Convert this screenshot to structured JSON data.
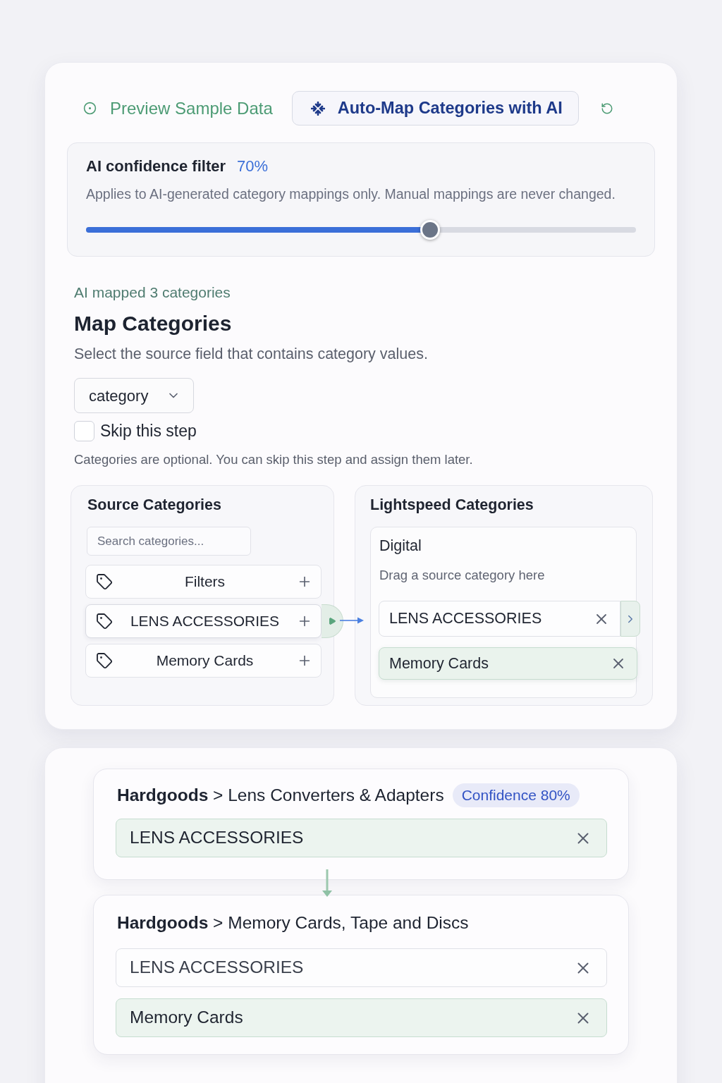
{
  "toolbar": {
    "preview_link": {
      "label": "Preview Sample Data"
    },
    "auto_map_button": {
      "label": "Auto-Map Categories with AI"
    }
  },
  "confidence_filter": {
    "title": "AI confidence filter",
    "value": "70%",
    "description": "Applies to AI-generated category mappings only. Manual mappings are never changed.",
    "level": 0.625
  },
  "status": "AI mapped 3 categories",
  "heading": "Map Categories",
  "instruction": "Select the source field that contains category values.",
  "source_field_select": {
    "value": "category"
  },
  "skip_step": {
    "label": "Skip this step",
    "checked": false
  },
  "hint": "Categories are optional. You can skip this step and assign them later.",
  "source_panel": {
    "title": "Source Categories",
    "search": {
      "placeholder": "Search categories..."
    },
    "items": [
      {
        "label": "Filters",
        "selected": false
      },
      {
        "label": "LENS ACCESSORIES",
        "selected": true
      },
      {
        "label": "Memory Cards",
        "selected": false
      }
    ]
  },
  "target_panel": {
    "title": "Lightspeed Categories",
    "group": {
      "name": "Digital",
      "drop_hint": "Drag a source category here",
      "items": [
        {
          "label": "LENS ACCESSORIES",
          "highlighted": false,
          "selected": true
        },
        {
          "label": "Memory Cards",
          "highlighted": true,
          "selected": false
        }
      ]
    }
  },
  "mapping_groups": [
    {
      "title": "**Hardgoods** > Lens Converters & Adapters",
      "badge": "Confidence 80%",
      "items": [
        {
          "label": "LENS ACCESSORIES",
          "highlighted": true
        }
      ]
    },
    {
      "title": "**Hardgoods** > Memory Cards, Tape and Discs",
      "items": [
        {
          "label": "LENS ACCESSORIES",
          "highlighted": false
        },
        {
          "label": "Memory Cards",
          "highlighted": true
        }
      ]
    }
  ]
}
